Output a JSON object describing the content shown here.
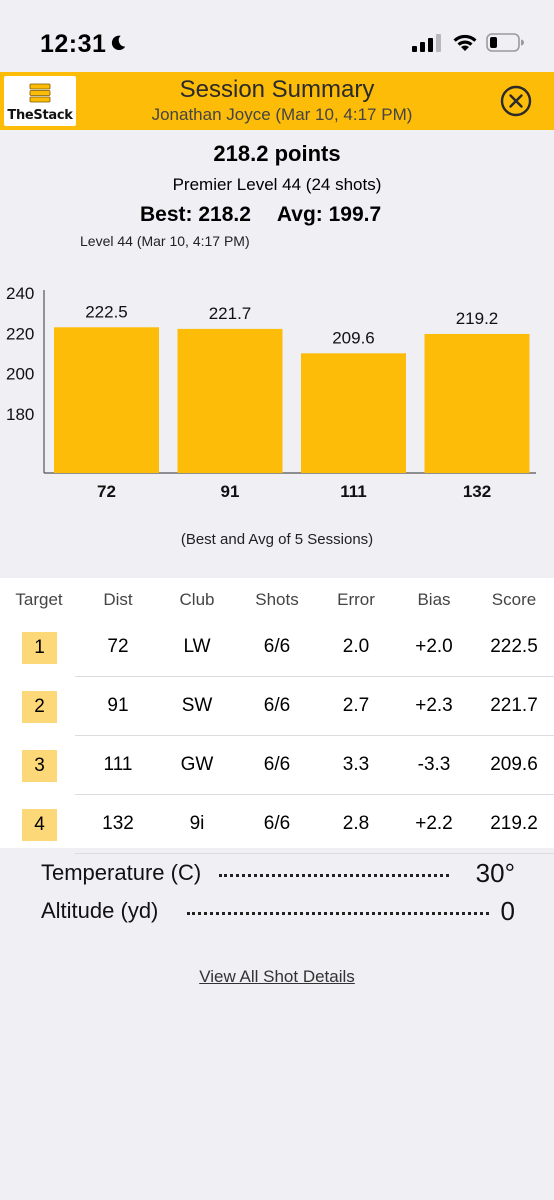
{
  "status_bar": {
    "time": "12:31"
  },
  "header": {
    "logo_text": "TheStack",
    "title": "Session Summary",
    "subtitle": "Jonathan Joyce (Mar 10, 4:17 PM)"
  },
  "summary": {
    "points": "218.2 points",
    "level_shots": "Premier Level 44 (24 shots)",
    "best": "Best: 218.2",
    "avg": "Avg: 199.7",
    "best_level": "Level 44 (Mar 10, 4:17 PM)"
  },
  "chart_data": {
    "type": "bar",
    "categories": [
      "72",
      "91",
      "111",
      "132"
    ],
    "values": [
      222.5,
      221.7,
      209.6,
      219.2
    ],
    "value_labels": [
      "222.5",
      "221.7",
      "209.6",
      "219.2"
    ],
    "y_ticks": [
      "240",
      "220",
      "200",
      "180"
    ],
    "caption": "(Best and Avg of 5 Sessions)",
    "bar_color": "#fcbc08"
  },
  "table": {
    "headers": [
      "Target",
      "Dist",
      "Club",
      "Shots",
      "Error",
      "Bias",
      "Score"
    ],
    "rows": [
      {
        "target": "1",
        "dist": "72",
        "club": "LW",
        "shots": "6/6",
        "error": "2.0",
        "bias": "+2.0",
        "score": "222.5"
      },
      {
        "target": "2",
        "dist": "91",
        "club": "SW",
        "shots": "6/6",
        "error": "2.7",
        "bias": "+2.3",
        "score": "221.7"
      },
      {
        "target": "3",
        "dist": "111",
        "club": "GW",
        "shots": "6/6",
        "error": "3.3",
        "bias": "-3.3",
        "score": "209.6"
      },
      {
        "target": "4",
        "dist": "132",
        "club": "9i",
        "shots": "6/6",
        "error": "2.8",
        "bias": "+2.2",
        "score": "219.2"
      }
    ]
  },
  "conditions": {
    "temperature_label": "Temperature (C)",
    "temperature_value": "30°",
    "altitude_label": "Altitude (yd)",
    "altitude_value": "0"
  },
  "links": {
    "view_all": "View All Shot Details"
  },
  "colors": {
    "accent": "#fcbc08",
    "target_badge": "#fcd878",
    "background": "#efeff4"
  }
}
